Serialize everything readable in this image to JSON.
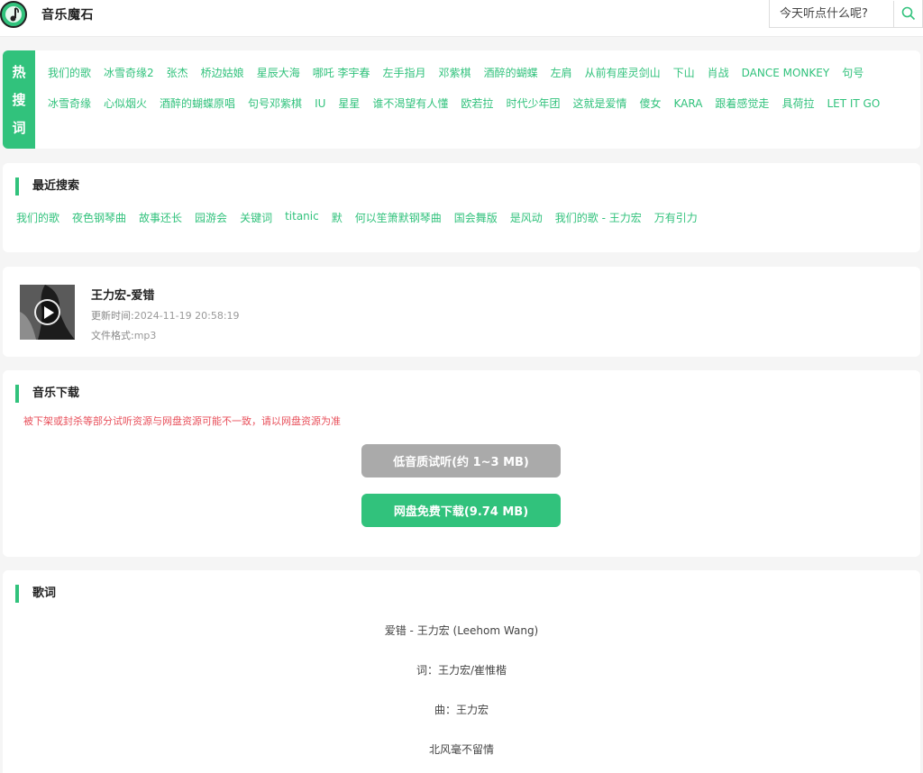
{
  "header": {
    "site_title": "音乐魔石",
    "search_placeholder": "今天听点什么呢?"
  },
  "hot": {
    "badge": [
      "热",
      "搜",
      "词"
    ],
    "items": [
      "我们的歌",
      "冰雪奇缘2",
      "张杰",
      "桥边姑娘",
      "星辰大海",
      "哪吒 李宇春",
      "左手指月",
      "邓紫棋",
      "酒醉的蝴蝶",
      "左肩",
      "从前有座灵剑山",
      "下山",
      "肖战",
      "DANCE MONKEY",
      "句号",
      "冰雪奇缘",
      "心似烟火",
      "酒醉的蝴蝶原唱",
      "句号邓紫棋",
      "IU",
      "星星",
      "谁不渴望有人懂",
      "欧若拉",
      "时代少年团",
      "这就是爱情",
      "傻女",
      "KARA",
      "跟着感觉走",
      "具荷拉",
      "LET IT GO"
    ]
  },
  "recent": {
    "title": "最近搜索",
    "items": [
      "我们的歌",
      "夜色钢琴曲",
      "故事还长",
      "园游会",
      "关键词",
      "titanic",
      "默",
      "何以笙箫默钢琴曲",
      "国会舞版",
      "是风动",
      "我们的歌 - 王力宏",
      "万有引力"
    ]
  },
  "song": {
    "name": "王力宏-爱错",
    "updated_label": "更新时间:",
    "updated_value": "2024-11-19 20:58:19",
    "format_label": "文件格式:",
    "format_value": "mp3"
  },
  "download": {
    "title": "音乐下载",
    "notice": "被下架或封杀等部分试听资源与网盘资源可能不一致，请以网盘资源为准",
    "low_button": "低音质试听(约 1~3 MB)",
    "free_button": "网盘免费下载(9.74 MB)"
  },
  "lyrics": {
    "title": "歌词",
    "lines": [
      "爱错 - 王力宏 (Leehom Wang)",
      "词：王力宏/崔惟楷",
      "曲：王力宏",
      "北风毫不留情"
    ]
  },
  "colors": {
    "accent": "#31c27c",
    "notice": "#e8505b",
    "disabled": "#aaaaaa"
  }
}
